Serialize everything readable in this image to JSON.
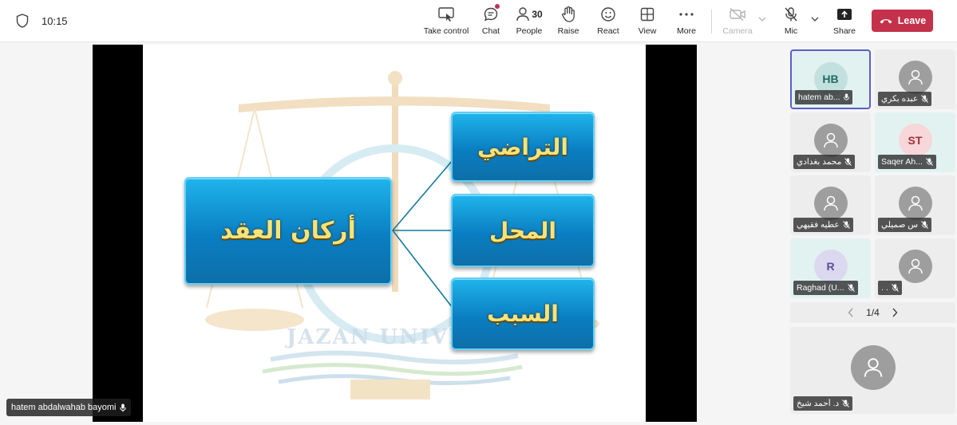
{
  "topbar": {
    "timer": "10:15",
    "buttons": {
      "take_control": "Take control",
      "chat": "Chat",
      "people": "People",
      "people_count": "30",
      "raise": "Raise",
      "react": "React",
      "view": "View",
      "more": "More",
      "camera": "Camera",
      "mic": "Mic",
      "share": "Share"
    },
    "leave": "Leave"
  },
  "slide": {
    "main_box": "أركان العقد",
    "branches": [
      "التراضي",
      "المحل",
      "السبب"
    ],
    "watermark": "JAZAN UNIVERSI"
  },
  "presenter": "hatem abdalwahab bayomi",
  "participants": [
    {
      "initials": "HB",
      "name": "hatem ab..."
    },
    {
      "initials": "",
      "name": "عبده بكري"
    },
    {
      "initials": "",
      "name": "محمد بغدادي"
    },
    {
      "initials": "ST",
      "name": "Saqer Ah..."
    },
    {
      "initials": "",
      "name": "عطيه فقيهي"
    },
    {
      "initials": "",
      "name": "س صميلي"
    },
    {
      "initials": "R",
      "name": "Raghad (U..."
    },
    {
      "initials": "",
      "name": ". ."
    }
  ],
  "pager": "1/4",
  "spotlight": {
    "name": "د. أحمد شيخ"
  },
  "colors": {
    "leave": "#c4314b",
    "active_border": "#5b5fc7",
    "slide_box": "#0a7ec2",
    "slide_text": "#f7e37a"
  }
}
